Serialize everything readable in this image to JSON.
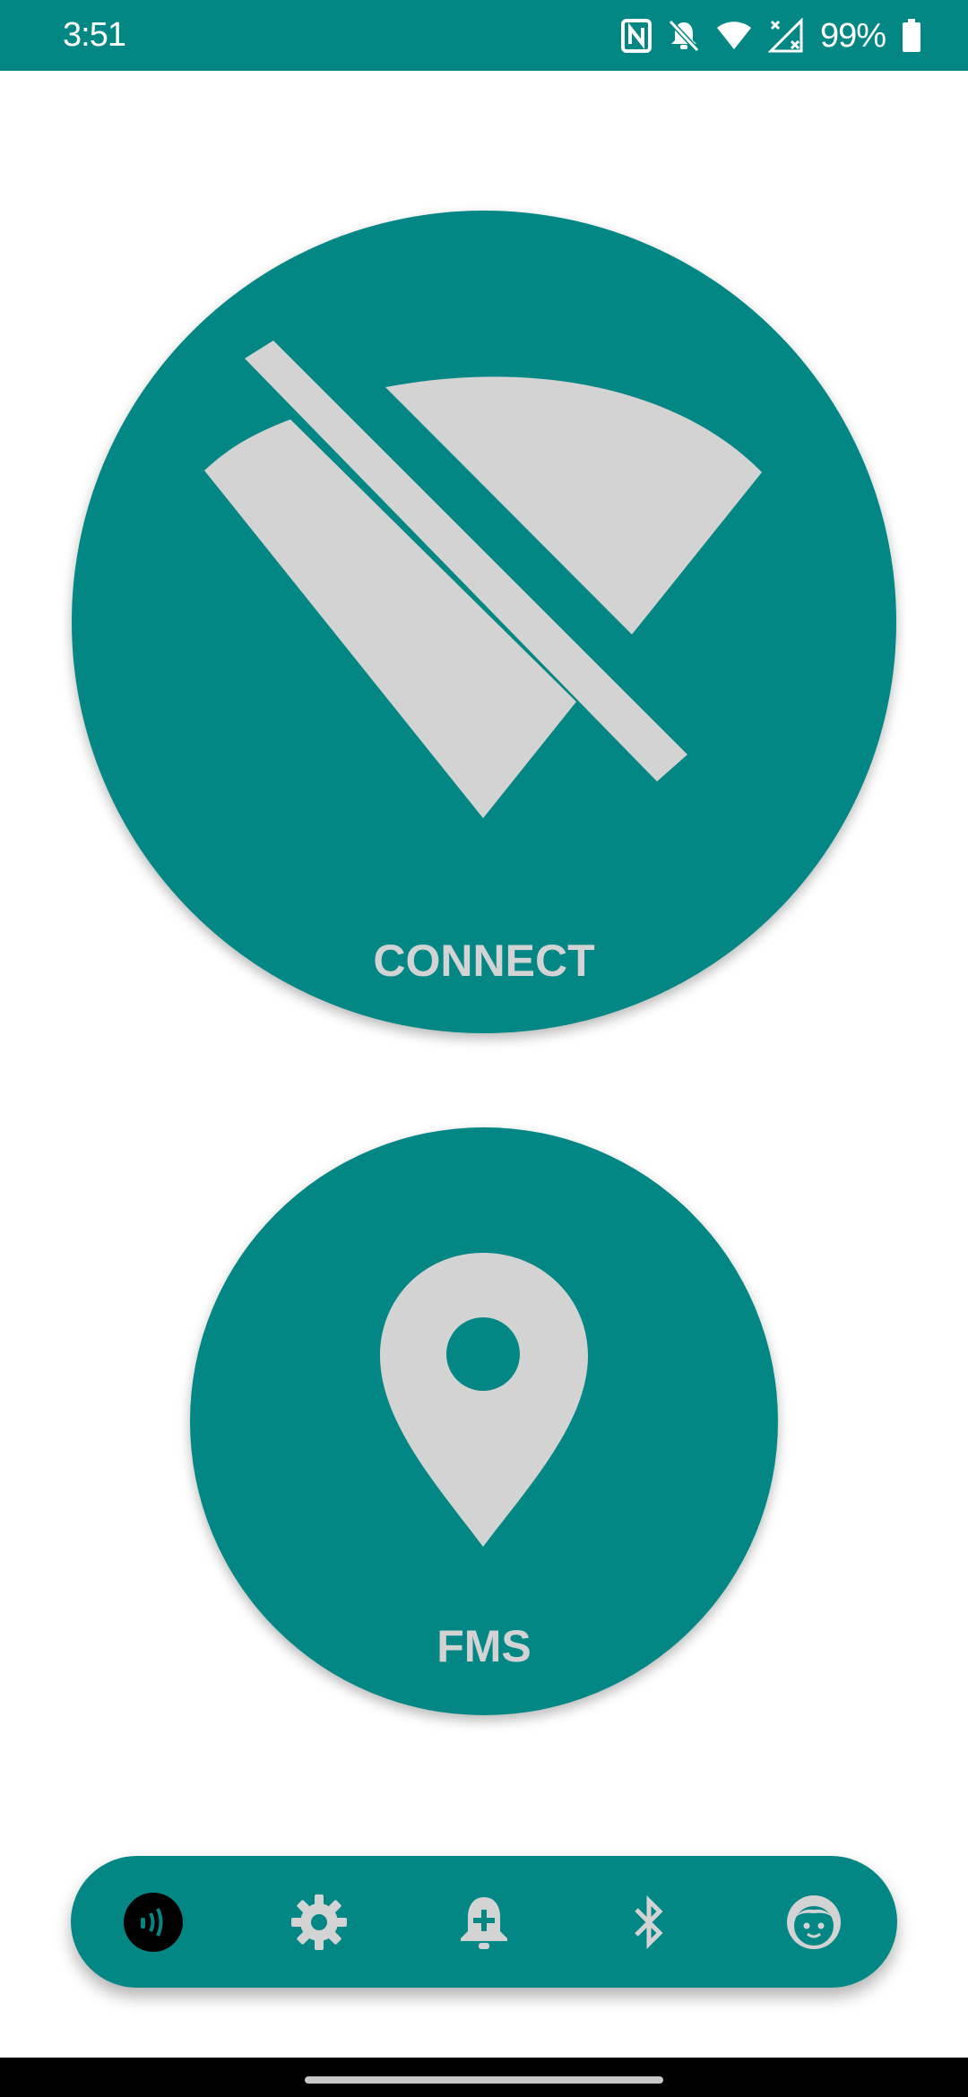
{
  "status_bar": {
    "time": "3:51",
    "battery": "99%",
    "icons": [
      "nfc-icon",
      "bell-off-icon",
      "wifi-icon",
      "signal-no-service-icon",
      "battery-icon"
    ],
    "background": "#038784"
  },
  "connect_button": {
    "label": "CONNECT",
    "icon": "wifi-off-icon"
  },
  "fms_button": {
    "label": "FMS",
    "icon": "location-pin-icon"
  },
  "bottom_nav": {
    "items": [
      {
        "name": "nfc-scan",
        "icon": "nfc-waves-icon"
      },
      {
        "name": "settings",
        "icon": "gear-icon"
      },
      {
        "name": "add-alarm",
        "icon": "bell-plus-icon"
      },
      {
        "name": "bluetooth",
        "icon": "bluetooth-icon"
      },
      {
        "name": "profile",
        "icon": "face-icon"
      }
    ]
  },
  "colors": {
    "accent": "#038784",
    "icon_fill": "#d3d3d3",
    "background": "#ffffff"
  }
}
